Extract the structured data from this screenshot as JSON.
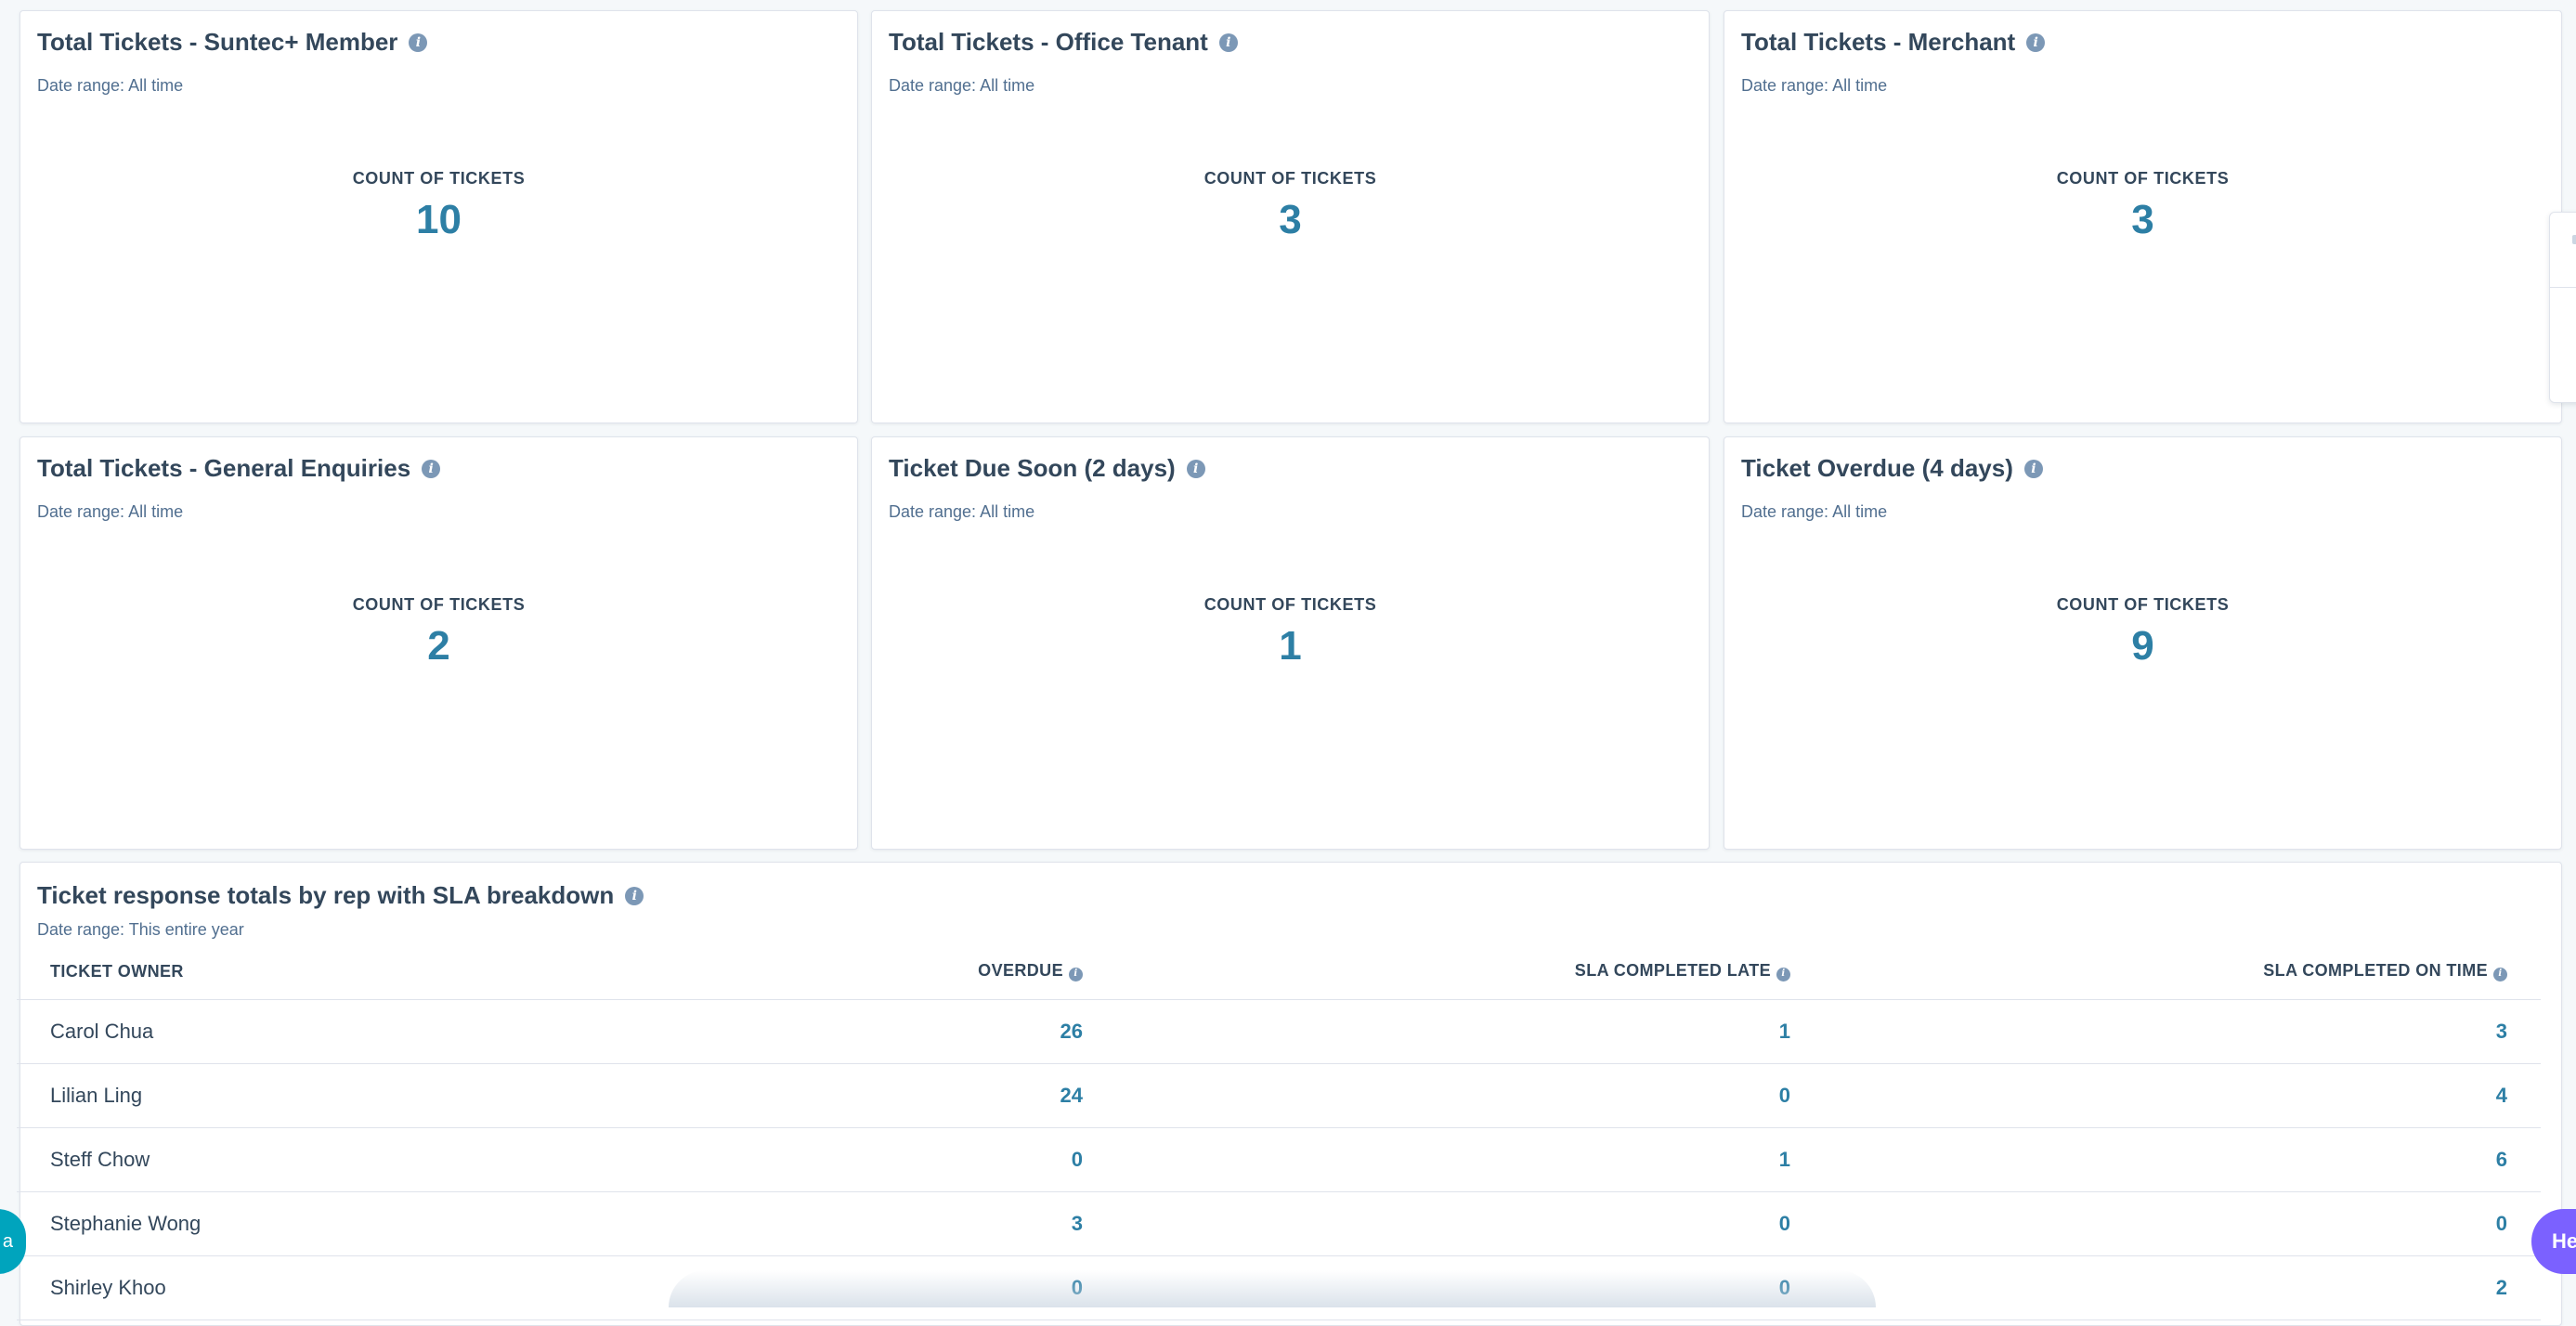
{
  "cards": [
    {
      "title": "Total Tickets - Suntec+ Member",
      "date_range": "Date range: All time",
      "metric_label": "COUNT OF TICKETS",
      "value": "10"
    },
    {
      "title": "Total Tickets - Office Tenant",
      "date_range": "Date range: All time",
      "metric_label": "COUNT OF TICKETS",
      "value": "3"
    },
    {
      "title": "Total Tickets - Merchant",
      "date_range": "Date range: All time",
      "metric_label": "COUNT OF TICKETS",
      "value": "3"
    },
    {
      "title": "Total Tickets - General Enquiries",
      "date_range": "Date range: All time",
      "metric_label": "COUNT OF TICKETS",
      "value": "2"
    },
    {
      "title": "Ticket Due Soon (2 days)",
      "date_range": "Date range: All time",
      "metric_label": "COUNT OF TICKETS",
      "value": "1"
    },
    {
      "title": "Ticket Overdue (4 days)",
      "date_range": "Date range: All time",
      "metric_label": "COUNT OF TICKETS",
      "value": "9"
    }
  ],
  "table_report": {
    "title": "Ticket response totals by rep with SLA breakdown",
    "date_range": "Date range: This entire year",
    "columns": [
      "TICKET OWNER",
      "OVERDUE",
      "SLA COMPLETED LATE",
      "SLA COMPLETED ON TIME"
    ],
    "rows": [
      {
        "owner": "Carol Chua",
        "overdue": "26",
        "late": "1",
        "on_time": "3"
      },
      {
        "owner": "Lilian Ling",
        "overdue": "24",
        "late": "0",
        "on_time": "4"
      },
      {
        "owner": "Steff Chow",
        "overdue": "0",
        "late": "1",
        "on_time": "6"
      },
      {
        "owner": "Stephanie Wong",
        "overdue": "3",
        "late": "0",
        "on_time": "0"
      },
      {
        "owner": "Shirley Khoo",
        "overdue": "0",
        "late": "0",
        "on_time": "2"
      }
    ]
  },
  "chat_widget": {
    "label": "a"
  },
  "help_button": {
    "label": "Hel"
  },
  "colors": {
    "accent": "#2d7fa5",
    "text": "#33475b",
    "muted": "#516f90",
    "info_icon": "#7c98b6",
    "chat": "#00a4bd",
    "help": "#7b61ff"
  },
  "icons": {
    "info": "info-icon"
  }
}
